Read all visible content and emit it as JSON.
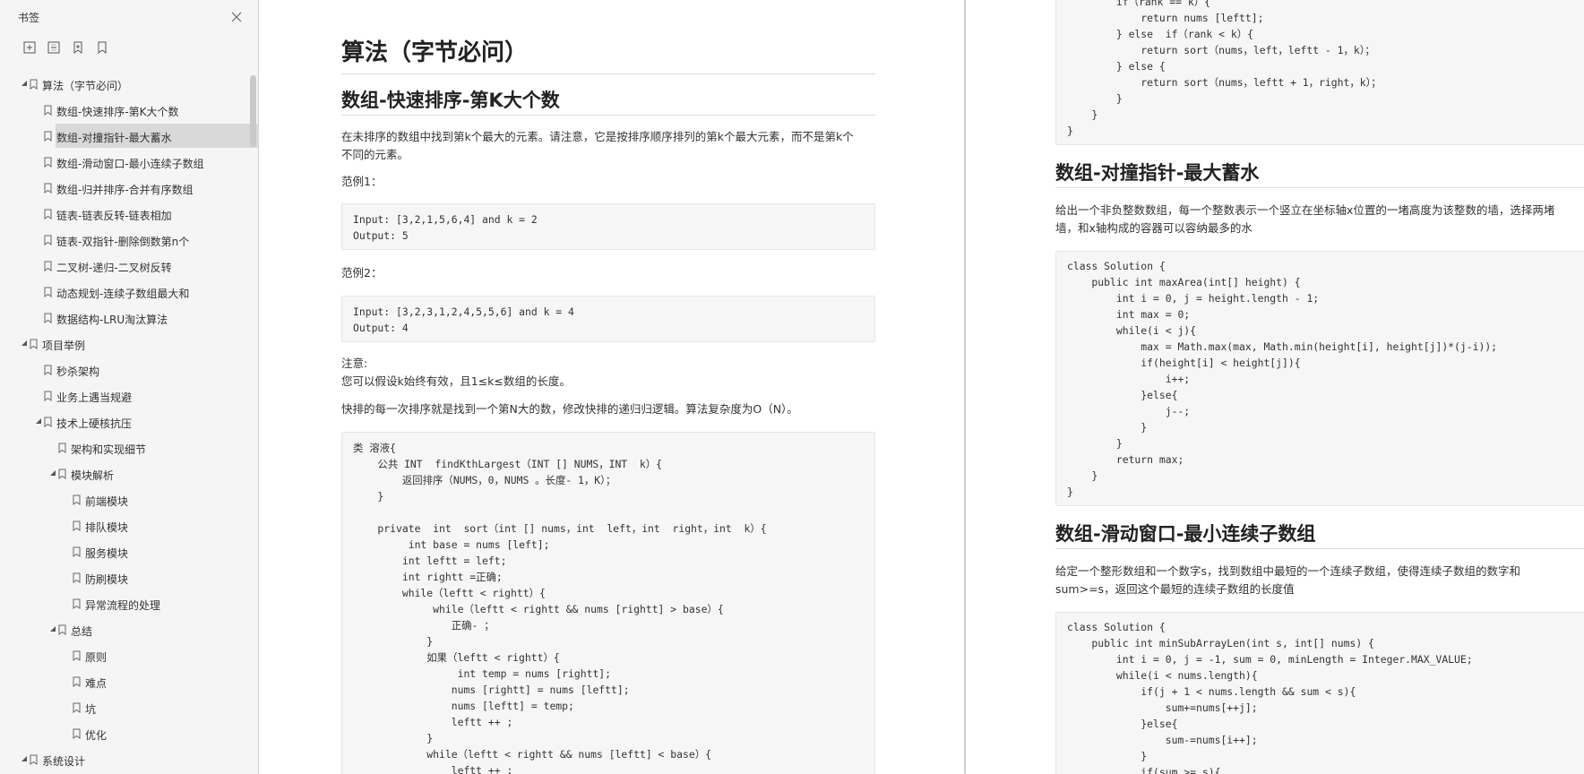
{
  "sidebar": {
    "title": "书签",
    "tools": [
      {
        "name": "expand-all-icon"
      },
      {
        "name": "collapse-all-icon"
      },
      {
        "name": "add-bookmark-icon"
      },
      {
        "name": "bookmark-icon"
      }
    ],
    "items": [
      {
        "label": "算法（字节必问）",
        "level": 0,
        "twisty": "open"
      },
      {
        "label": "数组-快速排序-第K大个数",
        "level": 1
      },
      {
        "label": "数组-对撞指针-最大蓄水",
        "level": 1,
        "selected": true
      },
      {
        "label": "数组-滑动窗口-最小连续子数组",
        "level": 1
      },
      {
        "label": "数组-归并排序-合并有序数组",
        "level": 1
      },
      {
        "label": "链表-链表反转-链表相加",
        "level": 1
      },
      {
        "label": "链表-双指针-删除倒数第n个",
        "level": 1
      },
      {
        "label": "二叉树-递归-二叉树反转",
        "level": 1
      },
      {
        "label": "动态规划-连续子数组最大和",
        "level": 1
      },
      {
        "label": "数据结构-LRU淘汰算法",
        "level": 1
      },
      {
        "label": "项目举例",
        "level": 0,
        "twisty": "open"
      },
      {
        "label": "秒杀架构",
        "level": 1
      },
      {
        "label": "业务上遇当规避",
        "level": 1
      },
      {
        "label": "技术上硬核抗压",
        "level": 1,
        "twisty": "open"
      },
      {
        "label": "架构和实现细节",
        "level": 2
      },
      {
        "label": "模块解析",
        "level": 2,
        "twisty": "open"
      },
      {
        "label": "前端模块",
        "level": 3
      },
      {
        "label": "排队模块",
        "level": 3
      },
      {
        "label": "服务模块",
        "level": 3
      },
      {
        "label": "防刷模块",
        "level": 3
      },
      {
        "label": "异常流程的处理",
        "level": 3
      },
      {
        "label": "总结",
        "level": 2,
        "twisty": "open"
      },
      {
        "label": "原则",
        "level": 3
      },
      {
        "label": "难点",
        "level": 3
      },
      {
        "label": "坑",
        "level": 3
      },
      {
        "label": "优化",
        "level": 3
      },
      {
        "label": "系统设计",
        "level": 0,
        "twisty": "open"
      }
    ]
  },
  "page1": {
    "title": "算法（字节必问）",
    "section_title": "数组-快速排序-第K大个数",
    "intro": [
      "在未排序的数组中找到第k个最大的元素。请注意，它是按排序顺序排列的第k个最大元素，而不是第k个",
      "不同的元素。"
    ],
    "example1_label": "范例1：",
    "example1_code": [
      "Input: [3,2,1,5,6,4] and k = 2",
      "Output: 5"
    ],
    "example2_label": "范例2：",
    "example2_code": [
      "Input: [3,2,3,1,2,4,5,5,6] and k = 4",
      "Output: 4"
    ],
    "note_label": "注意:",
    "note_text": "您可以假设k始终有效，且1≤k≤数组的长度。",
    "approach": "快排的每一次排序就是找到一个第N大的数，修改快排的递归归逻辑。算法复杂度为O（N）。",
    "solution_code": [
      "类 溶液{",
      "    公共 INT  findKthLargest（INT [] NUMS，INT  k）{",
      "        返回排序（NUMS，0，NUMS 。长度- 1，K）；",
      "    }",
      "",
      "    private  int  sort（int [] nums，int  left，int  right，int  k）{",
      "         int base = nums [left];",
      "        int leftt = left;",
      "        int rightt =正确;",
      "        while（leftt < rightt）{",
      "             while（leftt < rightt && nums [rightt] > base）{",
      "                正确- ；",
      "            }",
      "            如果（leftt < rightt）{",
      "                 int temp = nums [rightt];",
      "                nums [rightt] = nums [leftt];",
      "                nums [leftt] = temp;",
      "                leftt ++ ;",
      "            }",
      "            while（leftt < rightt && nums [leftt] < base）{",
      "                leftt ++ ;"
    ]
  },
  "page2": {
    "top_code": [
      "        if（rank == k）{",
      "            return nums [leftt];",
      "        } else  if（rank < k）{",
      "            return sort（nums，left，leftt - 1，k）；",
      "        } else {",
      "            return sort（nums，leftt + 1，right，k）；",
      "        }",
      "    }",
      "}"
    ],
    "section2_title": "数组-对撞指针-最大蓄水",
    "section2_desc": [
      "给出一个非负整数数组，每一个整数表示一个竖立在坐标轴x位置的一堵高度为该整数的墙，选择两堵",
      "墙，和x轴构成的容器可以容纳最多的水"
    ],
    "section2_code": [
      "class Solution {",
      "    public int maxArea(int[] height) {",
      "        int i = 0, j = height.length - 1;",
      "        int max = 0;",
      "        while(i < j){",
      "            max = Math.max(max, Math.min(height[i], height[j])*(j-i));",
      "            if(height[i] < height[j]){",
      "                i++;",
      "            }else{",
      "                j--;",
      "            }",
      "        }",
      "        return max;",
      "    }",
      "}"
    ],
    "section3_title": "数组-滑动窗口-最小连续子数组",
    "section3_desc": [
      "给定一个整形数组和一个数字s，找到数组中最短的一个连续子数组，使得连续子数组的数字和",
      "sum>=s，返回这个最短的连续子数组的长度值"
    ],
    "section3_code": [
      "class Solution {",
      "    public int minSubArrayLen(int s, int[] nums) {",
      "        int i = 0, j = -1, sum = 0, minLength = Integer.MAX_VALUE;",
      "        while(i < nums.length){",
      "            if(j + 1 < nums.length && sum < s){",
      "                sum+=nums[++j];",
      "            }else{",
      "                sum-=nums[i++];",
      "            }",
      "            if(sum >= s){"
    ]
  }
}
